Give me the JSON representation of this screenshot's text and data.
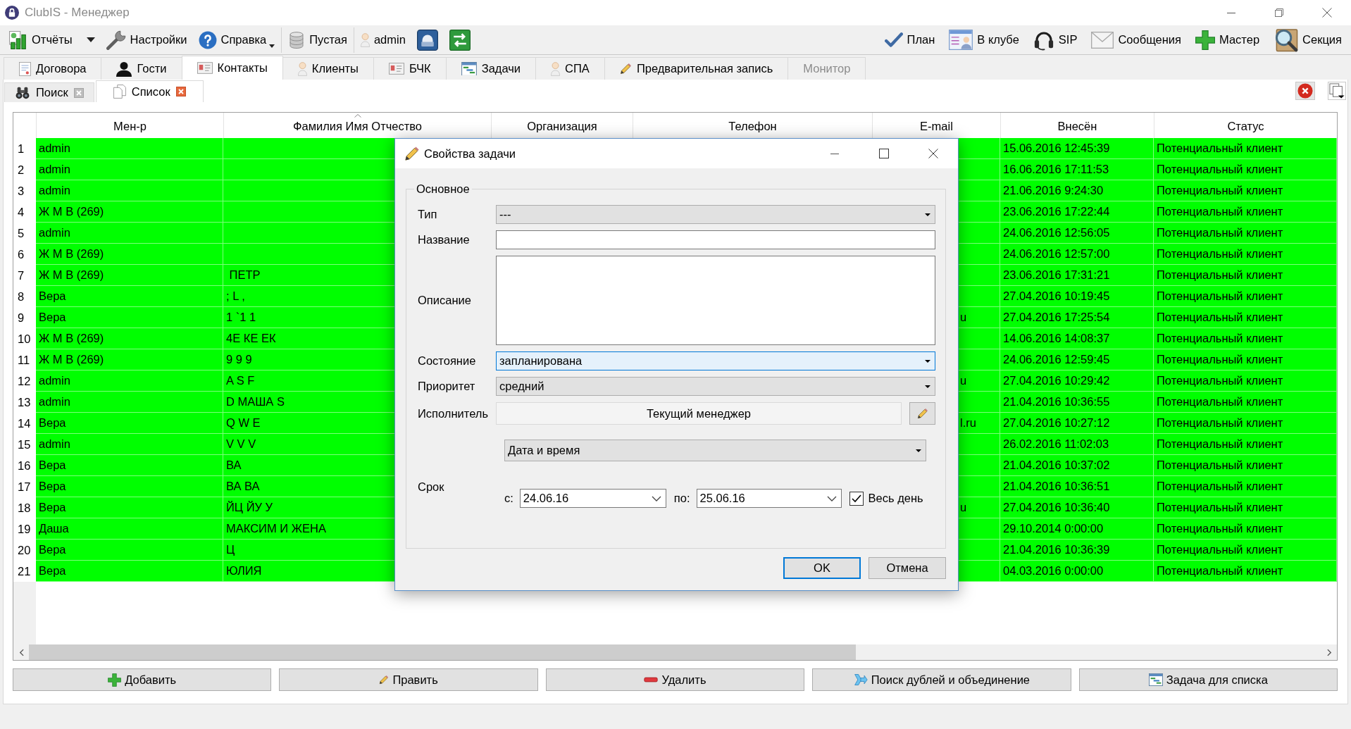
{
  "window": {
    "title": "ClubIS - Менеджер"
  },
  "toolbar": {
    "left": [
      [
        {
          "kind": "menu",
          "label": "Отчёты"
        },
        {
          "kind": "button",
          "label": "Настройки"
        },
        {
          "kind": "split",
          "label": "Справка"
        }
      ],
      [
        {
          "kind": "button",
          "label": "Пустая"
        }
      ],
      [
        {
          "kind": "button",
          "label": "admin"
        },
        {
          "kind": "icon"
        },
        {
          "kind": "icon"
        }
      ]
    ],
    "right": [
      {
        "label": "План"
      },
      {
        "label": "В клубе"
      },
      {
        "label": "SIP"
      },
      {
        "label": "Сообщения"
      },
      {
        "label": "Мастер"
      },
      {
        "label": "Секция"
      }
    ]
  },
  "tabs": [
    {
      "label": "Договора",
      "selected": false,
      "disabled": false
    },
    {
      "label": "Гости",
      "selected": false,
      "disabled": false
    },
    {
      "label": "Контакты",
      "selected": true,
      "disabled": false
    },
    {
      "label": "Клиенты",
      "selected": false,
      "disabled": false
    },
    {
      "label": "БЧК",
      "selected": false,
      "disabled": false
    },
    {
      "label": "Задачи",
      "selected": false,
      "disabled": false
    },
    {
      "label": "СПА",
      "selected": false,
      "disabled": false
    },
    {
      "label": "Предварительная запись",
      "selected": false,
      "disabled": false
    },
    {
      "label": "Монитор",
      "selected": false,
      "disabled": true
    }
  ],
  "subtabs": [
    {
      "label": "Поиск",
      "selected": false
    },
    {
      "label": "Список",
      "selected": true
    }
  ],
  "table": {
    "columns": [
      {
        "label": "Мен-р",
        "sorted": false
      },
      {
        "label": "Фамилия Имя Отчество",
        "sorted": true
      },
      {
        "label": "Организация",
        "sorted": false
      },
      {
        "label": "Телефон",
        "sorted": false
      },
      {
        "label": "E-mail",
        "sorted": false
      },
      {
        "label": "Внесён",
        "sorted": false
      },
      {
        "label": "Статус",
        "sorted": false
      }
    ],
    "rows": [
      {
        "number": "1",
        "manager": "admin",
        "added": "15.06.2016 12:45:39",
        "status": "Потенциальный клиент"
      },
      {
        "number": "2",
        "manager": "admin",
        "added": "16.06.2016 17:11:53",
        "status": "Потенциальный клиент"
      },
      {
        "number": "3",
        "manager": "admin",
        "added": "21.06.2016 9:24:30",
        "status": "Потенциальный клиент"
      },
      {
        "number": "4",
        "manager": "Ж М В (269)",
        "added": "23.06.2016 17:22:44",
        "status": "Потенциальный клиент"
      },
      {
        "number": "5",
        "manager": "admin",
        "added": "24.06.2016 12:56:05",
        "status": "Потенциальный клиент"
      },
      {
        "number": "6",
        "manager": "Ж М В (269)",
        "added": "24.06.2016 12:57:00",
        "status": "Потенциальный клиент"
      },
      {
        "number": "7",
        "manager": "Ж М В (269)",
        "name": " ПЕТР",
        "added": "23.06.2016 17:31:21",
        "status": "Потенциальный клиент"
      },
      {
        "number": "8",
        "manager": "Вера",
        "name": "; L ,",
        "added": "27.04.2016 10:19:45",
        "status": "Потенциальный клиент"
      },
      {
        "number": "9",
        "manager": "Вера",
        "name": "1 `1 1",
        "email": "u",
        "added": "27.04.2016 17:25:54",
        "status": "Потенциальный клиент"
      },
      {
        "number": "10",
        "manager": "Ж М В (269)",
        "name": "4Е КЕ ЕК",
        "added": "14.06.2016 14:08:37",
        "status": "Потенциальный клиент"
      },
      {
        "number": "11",
        "manager": "Ж М В (269)",
        "name": "9 9 9",
        "added": "24.06.2016 12:59:45",
        "status": "Потенциальный клиент"
      },
      {
        "number": "12",
        "manager": "admin",
        "name": "A S F",
        "email": "u",
        "added": "27.04.2016 10:29:42",
        "status": "Потенциальный клиент"
      },
      {
        "number": "13",
        "manager": "admin",
        "name": "D МАША S",
        "added": "21.04.2016 10:36:55",
        "status": "Потенциальный клиент"
      },
      {
        "number": "14",
        "manager": "Вера",
        "name": "Q W E",
        "email": "l.ru",
        "added": "27.04.2016 10:27:12",
        "status": "Потенциальный клиент"
      },
      {
        "number": "15",
        "manager": "admin",
        "name": "V V V",
        "added": "26.02.2016 11:02:03",
        "status": "Потенциальный клиент"
      },
      {
        "number": "16",
        "manager": "Вера",
        "name": "ВА",
        "added": "21.04.2016 10:37:02",
        "status": "Потенциальный клиент"
      },
      {
        "number": "17",
        "manager": "Вера",
        "name": "ВА ВА",
        "added": "21.04.2016 10:36:51",
        "status": "Потенциальный клиент"
      },
      {
        "number": "18",
        "manager": "Вера",
        "name": "ЙЦ ЙУ У",
        "email": "u",
        "added": "27.04.2016 10:36:40",
        "status": "Потенциальный клиент"
      },
      {
        "number": "19",
        "manager": "Даша",
        "name": "МАКСИМ И ЖЕНА",
        "added": "29.10.2014 0:00:00",
        "status": "Потенциальный клиент"
      },
      {
        "number": "20",
        "manager": "Вера",
        "name": "Ц",
        "added": "21.04.2016 10:36:39",
        "status": "Потенциальный клиент"
      },
      {
        "number": "21",
        "manager": "Вера",
        "name": "ЮЛИЯ",
        "added": "04.03.2016 0:00:00",
        "status": "Потенциальный клиент"
      }
    ]
  },
  "actions": [
    {
      "label": "Добавить"
    },
    {
      "label": "Править"
    },
    {
      "label": "Удалить"
    },
    {
      "label": "Поиск дублей и объединение"
    },
    {
      "label": "Задача для списка"
    }
  ],
  "dialog": {
    "title": "Свойства задачи",
    "group": "Основное",
    "fields": [
      {
        "label": "Тип",
        "kind": "combo",
        "value": "---",
        "focused": false
      },
      {
        "label": "Название",
        "kind": "text"
      },
      {
        "label": "Описание",
        "kind": "textarea"
      },
      {
        "label": "Состояние",
        "kind": "combo",
        "value": "запланирована",
        "focused": true
      },
      {
        "label": "Приоритет",
        "kind": "combo",
        "value": "средний",
        "focused": false
      },
      {
        "label": "Исполнитель",
        "kind": "picker",
        "value": "Текущий менеджер"
      }
    ],
    "deadline": {
      "label": "Срок",
      "mode": "Дата и время",
      "from_label": "с:",
      "from": "24.06.16",
      "to_label": "по:",
      "to": "25.06.16",
      "all_day": {
        "label": "Весь день",
        "checked": true
      }
    },
    "buttons": [
      {
        "label": "OK",
        "default": true
      },
      {
        "label": "Отмена",
        "default": false
      }
    ]
  }
}
